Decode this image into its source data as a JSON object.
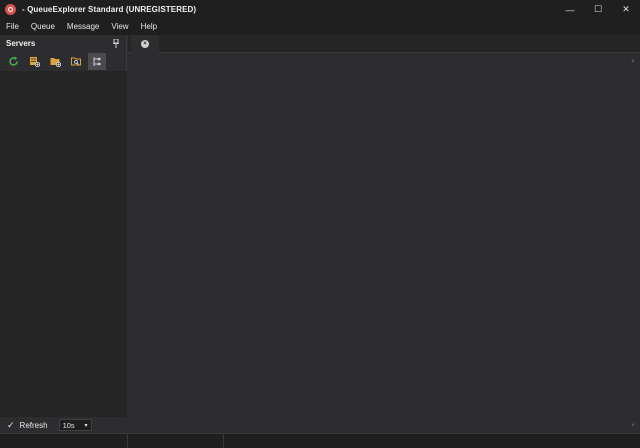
{
  "window": {
    "title": "- QueueExplorer Standard (UNREGISTERED)",
    "controls": {
      "minimize": "—",
      "maximize": "☐",
      "close": "✕"
    }
  },
  "menu": [
    "File",
    "Queue",
    "Message",
    "View",
    "Help"
  ],
  "servers_panel": {
    "title": "Servers",
    "toolbar_icons": [
      "refresh-icon",
      "add-server-icon",
      "add-folder-icon",
      "connect-icon",
      "tree-view-icon"
    ],
    "footer": {
      "refresh_checked": true,
      "check_glyph": "✓",
      "refresh_label": "Refresh",
      "interval_value": "10s",
      "caret": "▾"
    }
  },
  "document": {
    "tab_close_glyph": "×",
    "scroll_up_glyph": "▲",
    "scroll_down_glyph": "▼"
  },
  "colors": {
    "background": "#2d2d30",
    "titlebar": "#1f1f1f",
    "panel": "#252526",
    "refresh_icon": "#4caf50",
    "folder_icon": "#d9a441",
    "app_icon": "#d9534f"
  }
}
